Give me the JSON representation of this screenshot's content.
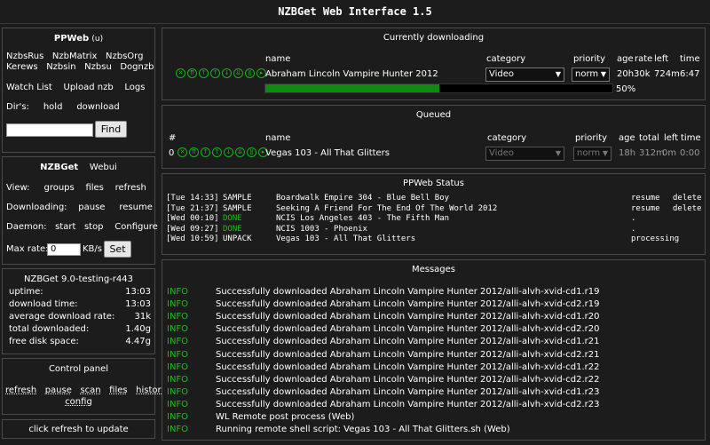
{
  "app": {
    "title": "NZBGet Web Interface 1.5"
  },
  "ppweb": {
    "title": "PPWeb",
    "title_suffix": "(u)",
    "links_row1": [
      "NzbsRus",
      "NzbMatrix",
      "NzbsOrg"
    ],
    "links_row2": [
      "Kerews",
      "Nzbsin",
      "Nzbsu",
      "Dognzb"
    ],
    "links_row3": [
      "Watch List",
      "Upload nzb",
      "Logs"
    ],
    "dirs_label": "Dir's:",
    "dirs": [
      "hold",
      "download"
    ],
    "search_value": "",
    "find_label": "Find"
  },
  "nzbget": {
    "title": "NZBGet",
    "webui": "Webui",
    "view_label": "View:",
    "view_links": [
      "groups",
      "files",
      "refresh"
    ],
    "downloading_label": "Downloading:",
    "downloading_links": [
      "pause",
      "resume"
    ],
    "daemon_label": "Daemon:",
    "daemon_links": [
      "start",
      "stop",
      "Configure"
    ],
    "maxrate_label": "Max rate:",
    "maxrate_value": "0",
    "maxrate_unit": "KB/s",
    "set_label": "Set"
  },
  "stats": {
    "version": "NZBGet 9.0-testing-r443",
    "rows": [
      {
        "k": "uptime:",
        "v": "13:03"
      },
      {
        "k": "download time:",
        "v": "13:03"
      },
      {
        "k": "average download rate:",
        "v": "31k"
      },
      {
        "k": "total downloaded:",
        "v": "1.40g"
      },
      {
        "k": "free disk space:",
        "v": "4.47g"
      }
    ]
  },
  "control": {
    "title": "Control panel",
    "links": [
      "refresh",
      "pause",
      "scan",
      "files",
      "history"
    ],
    "config": "config"
  },
  "refresh_hint": "click refresh to update",
  "current": {
    "title": "Currently downloading",
    "headers": {
      "name": "name",
      "category": "category",
      "priority": "priority",
      "age": "age",
      "rate": "rate",
      "left": "left",
      "time": "time"
    },
    "item": {
      "name": "Abraham Lincoln Vampire Hunter 2012",
      "category": "Video",
      "priority": "norm",
      "age": "20h",
      "rate": "30k",
      "left": "724m",
      "time": "6:47",
      "progress": 0.5,
      "progress_label": "50%"
    }
  },
  "queued": {
    "title": "Queued",
    "headers": {
      "num": "#",
      "name": "name",
      "category": "category",
      "priority": "priority",
      "age": "age",
      "total": "total",
      "left": "left",
      "time": "time"
    },
    "item": {
      "num": "0",
      "name": "Vegas 103 - All That Glitters",
      "category": "Video",
      "priority": "norm",
      "age": "18h",
      "total": "312m",
      "left": "0m",
      "time": "0:00"
    }
  },
  "ppstatus": {
    "title": "PPWeb Status",
    "rows": [
      {
        "time": "[Tue 14:33]",
        "status": "SAMPLE",
        "name": "Boardwalk Empire 304 - Blue Bell Boy",
        "a1": "resume",
        "a2": "delete"
      },
      {
        "time": "[Tue 21:37]",
        "status": "SAMPLE",
        "name": "Seeking A Friend For The End Of The World 2012",
        "a1": "resume",
        "a2": "delete"
      },
      {
        "time": "[Wed 00:10]",
        "status": "DONE",
        "name": "NCIS Los Angeles 403 - The Fifth Man",
        "a1": ".",
        "a2": ""
      },
      {
        "time": "[Wed 09:27]",
        "status": "DONE",
        "name": "NCIS 1003 - Phoenix",
        "a1": ".",
        "a2": ""
      },
      {
        "time": "[Wed 10:59]",
        "status": "UNPACK",
        "name": "Vegas 103 - All That Glitters",
        "a1": "processing",
        "a2": ""
      }
    ]
  },
  "messages": {
    "title": "Messages",
    "rows": [
      {
        "lvl": "INFO",
        "txt": "Successfully downloaded Abraham Lincoln Vampire Hunter 2012/alli-alvh-xvid-cd1.r19"
      },
      {
        "lvl": "INFO",
        "txt": "Successfully downloaded Abraham Lincoln Vampire Hunter 2012/alli-alvh-xvid-cd2.r19"
      },
      {
        "lvl": "INFO",
        "txt": "Successfully downloaded Abraham Lincoln Vampire Hunter 2012/alli-alvh-xvid-cd1.r20"
      },
      {
        "lvl": "INFO",
        "txt": "Successfully downloaded Abraham Lincoln Vampire Hunter 2012/alli-alvh-xvid-cd2.r20"
      },
      {
        "lvl": "INFO",
        "txt": "Successfully downloaded Abraham Lincoln Vampire Hunter 2012/alli-alvh-xvid-cd1.r21"
      },
      {
        "lvl": "INFO",
        "txt": "Successfully downloaded Abraham Lincoln Vampire Hunter 2012/alli-alvh-xvid-cd2.r21"
      },
      {
        "lvl": "INFO",
        "txt": "Successfully downloaded Abraham Lincoln Vampire Hunter 2012/alli-alvh-xvid-cd1.r22"
      },
      {
        "lvl": "INFO",
        "txt": "Successfully downloaded Abraham Lincoln Vampire Hunter 2012/alli-alvh-xvid-cd2.r22"
      },
      {
        "lvl": "INFO",
        "txt": "Successfully downloaded Abraham Lincoln Vampire Hunter 2012/alli-alvh-xvid-cd1.r23"
      },
      {
        "lvl": "INFO",
        "txt": "Successfully downloaded Abraham Lincoln Vampire Hunter 2012/alli-alvh-xvid-cd2.r23"
      },
      {
        "lvl": "INFO",
        "txt": "WL Remote post process (Web)"
      },
      {
        "lvl": "INFO",
        "txt": "Running remote shell script: Vegas 103 - All That Glitters.sh (Web)"
      }
    ]
  },
  "colors": {
    "accent": "#19c019",
    "progress": "#0e8a0e"
  }
}
